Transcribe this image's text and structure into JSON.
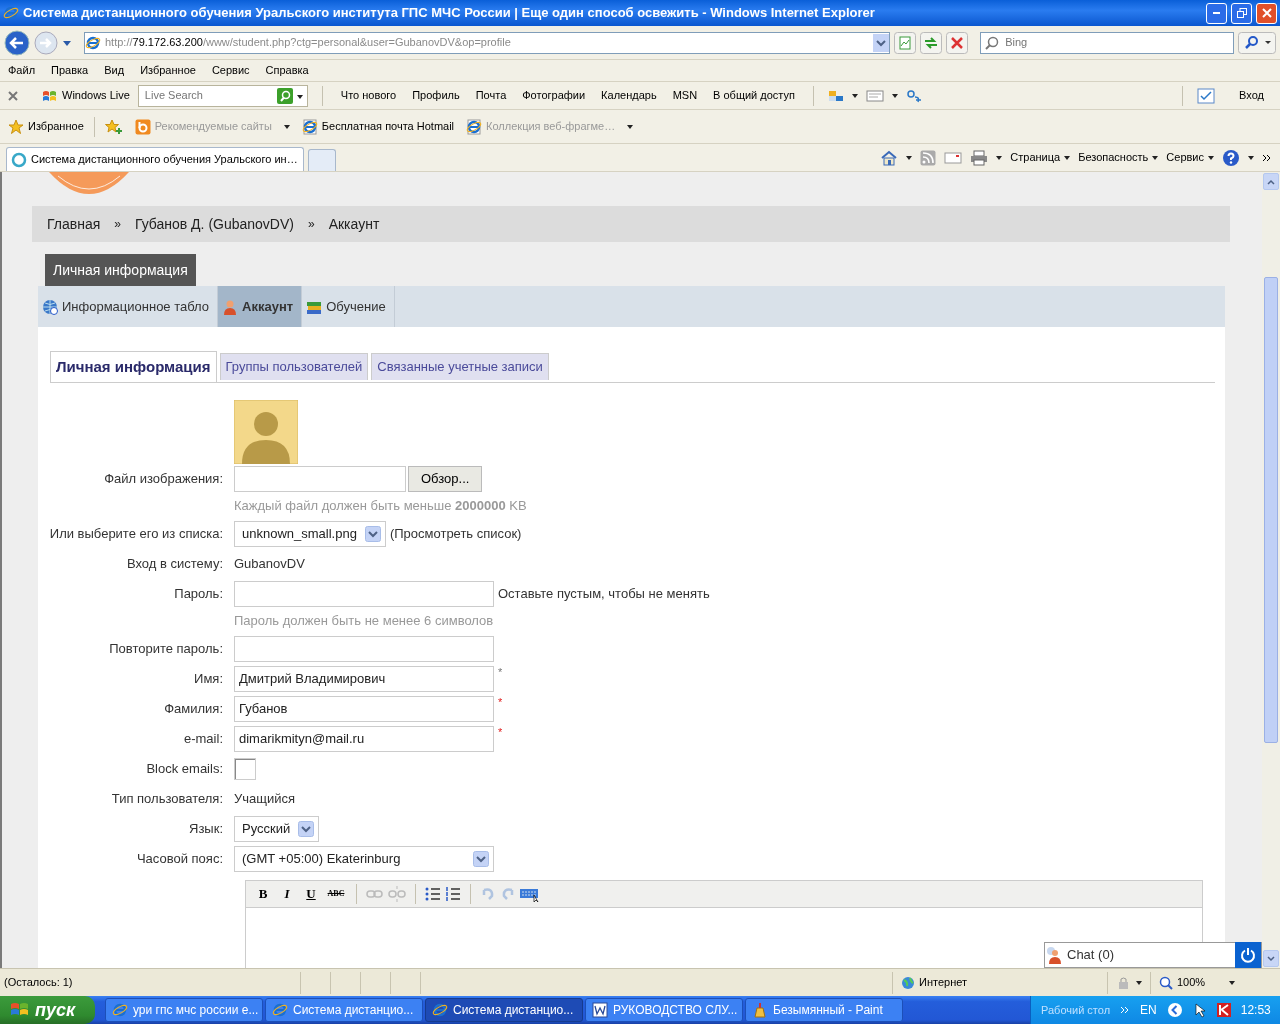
{
  "window": {
    "title": "Система дистанционного обучения Уральского института ГПС МЧС России | Еще один способ освежить  - Windows Internet Explorer"
  },
  "address_bar": {
    "scheme": "http://",
    "host": "79.172.63.200",
    "path": "/www/student.php?ctg=personal&user=GubanovDV&op=profile"
  },
  "search_box": {
    "placeholder": "Bing"
  },
  "menu_bar": [
    "Файл",
    "Правка",
    "Вид",
    "Избранное",
    "Сервис",
    "Справка"
  ],
  "live_toolbar": {
    "brand": "Windows Live",
    "search_placeholder": "Live Search",
    "links": [
      "Что нового",
      "Профиль",
      "Почта",
      "Фотографии",
      "Календарь",
      "MSN",
      "В общий доступ"
    ],
    "sign_in": "Вход"
  },
  "favorites_bar": {
    "label": "Избранное",
    "items": [
      {
        "label": "Рекомендуемые сайты",
        "kind": "feed",
        "disabled": true,
        "has_menu": true
      },
      {
        "label": "Бесплатная почта Hotmail",
        "kind": "page",
        "disabled": false,
        "has_menu": false
      },
      {
        "label": "Коллекция веб-фрагме…",
        "kind": "page",
        "disabled": true,
        "has_menu": true
      }
    ]
  },
  "browser_tabs": [
    {
      "label": "Система дистанционного обучения Уральского ин…",
      "selected": true
    }
  ],
  "command_bar": [
    "Страница",
    "Безопасность",
    "Сервис"
  ],
  "page": {
    "breadcrumb": [
      {
        "kind": "link",
        "text": "Главная"
      },
      {
        "kind": "separator",
        "text": "»"
      },
      {
        "kind": "link",
        "text": "Губанов Д. (GubanovDV)"
      },
      {
        "kind": "separator",
        "text": "»"
      },
      {
        "kind": "link",
        "text": "Аккаунт"
      }
    ],
    "section_title": "Личная информация",
    "nav_tabs": [
      {
        "label": "Информационное табло",
        "kind": "globe",
        "selected": false
      },
      {
        "label": "Аккаунт",
        "kind": "user",
        "selected": true
      },
      {
        "label": "Обучение",
        "kind": "books",
        "selected": false
      }
    ],
    "sub_tabs": [
      {
        "label": "Личная информация",
        "selected": true
      },
      {
        "label": "Группы пользователей",
        "selected": false
      },
      {
        "label": "Связанные учетные записи",
        "selected": false
      }
    ],
    "form": [
      {
        "kind": "avatar"
      },
      {
        "kind": "file",
        "label": "Файл изображения:",
        "button": "Обзор..."
      },
      {
        "kind": "hint",
        "text": "Каждый файл должен быть меньше **2000000** KB"
      },
      {
        "kind": "select",
        "label": "Или выберите его из списка:",
        "value": "unknown_small.png",
        "note": "(Просмотреть список)"
      },
      {
        "kind": "text",
        "label": "Вход в систему:",
        "value": "GubanovDV"
      },
      {
        "kind": "password",
        "label": "Пароль:",
        "note": "Оставьте пустым, чтобы не менять"
      },
      {
        "kind": "hint",
        "text": "Пароль должен быть не менее 6 символов"
      },
      {
        "kind": "password",
        "label": "Повторите пароль:"
      },
      {
        "kind": "input",
        "label": "Имя:",
        "value": "Дмитрий Владимирович",
        "mark": "*",
        "mark_red": false
      },
      {
        "kind": "input",
        "label": "Фамилия:",
        "value": "Губанов",
        "mark": "*",
        "mark_red": true
      },
      {
        "kind": "input",
        "label": "e-mail:",
        "value": "dimarikmityn@mail.ru",
        "mark": "*",
        "mark_red": true
      },
      {
        "kind": "checkbox",
        "label": "Block emails:",
        "checked": false
      },
      {
        "kind": "text",
        "label": "Тип пользователя:",
        "value": "Учащийся"
      },
      {
        "kind": "select",
        "label": "Язык:",
        "value": "Русский"
      },
      {
        "kind": "select",
        "label": "Часовой пояс:",
        "value": "(GMT +05:00) Ekaterinburg",
        "wide": true
      },
      {
        "kind": "editor",
        "buttons": [
          "B",
          "I",
          "U",
          "ABC"
        ]
      }
    ]
  },
  "chat": {
    "label": "Chat (0)"
  },
  "status_bar": {
    "text": "(Осталось: 1)",
    "zone": "Интернет",
    "zoom": "100%"
  },
  "taskbar": {
    "start": "пуск",
    "items": [
      {
        "label": "ури гпс мчс россии е...",
        "kind": "ie",
        "selected": false
      },
      {
        "label": "Система дистанцио...",
        "kind": "ie",
        "selected": false
      },
      {
        "label": "Система дистанцио...",
        "kind": "ie",
        "selected": true
      },
      {
        "label": "РУКОВОДСТВО СЛУ...",
        "kind": "word",
        "selected": false
      },
      {
        "label": "Безымянный - Paint",
        "kind": "paint",
        "selected": false
      }
    ],
    "desktop": "Рабочий стол",
    "language": "EN",
    "clock": "12:53"
  }
}
